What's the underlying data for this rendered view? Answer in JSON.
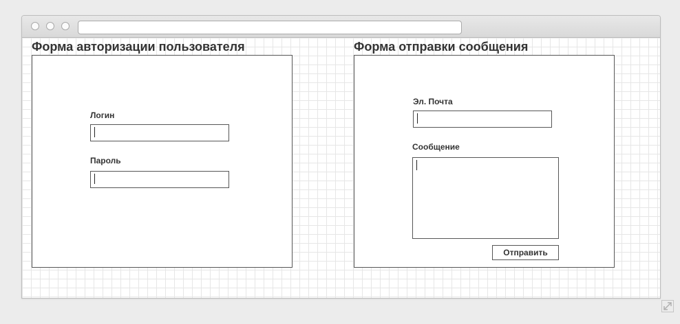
{
  "login_form": {
    "title": "Форма авторизации пользователя",
    "login_label": "Логин",
    "login_value": "",
    "password_label": "Пароль",
    "password_value": ""
  },
  "message_form": {
    "title": "Форма отправки сообщения",
    "email_label": "Эл. Почта",
    "email_value": "",
    "message_label": "Сообщение",
    "message_value": "",
    "submit_label": "Отправить"
  },
  "icons": {
    "window_controls": [
      "window-close-icon",
      "window-minimize-icon",
      "window-zoom-icon"
    ],
    "resize": "resize-icon"
  }
}
